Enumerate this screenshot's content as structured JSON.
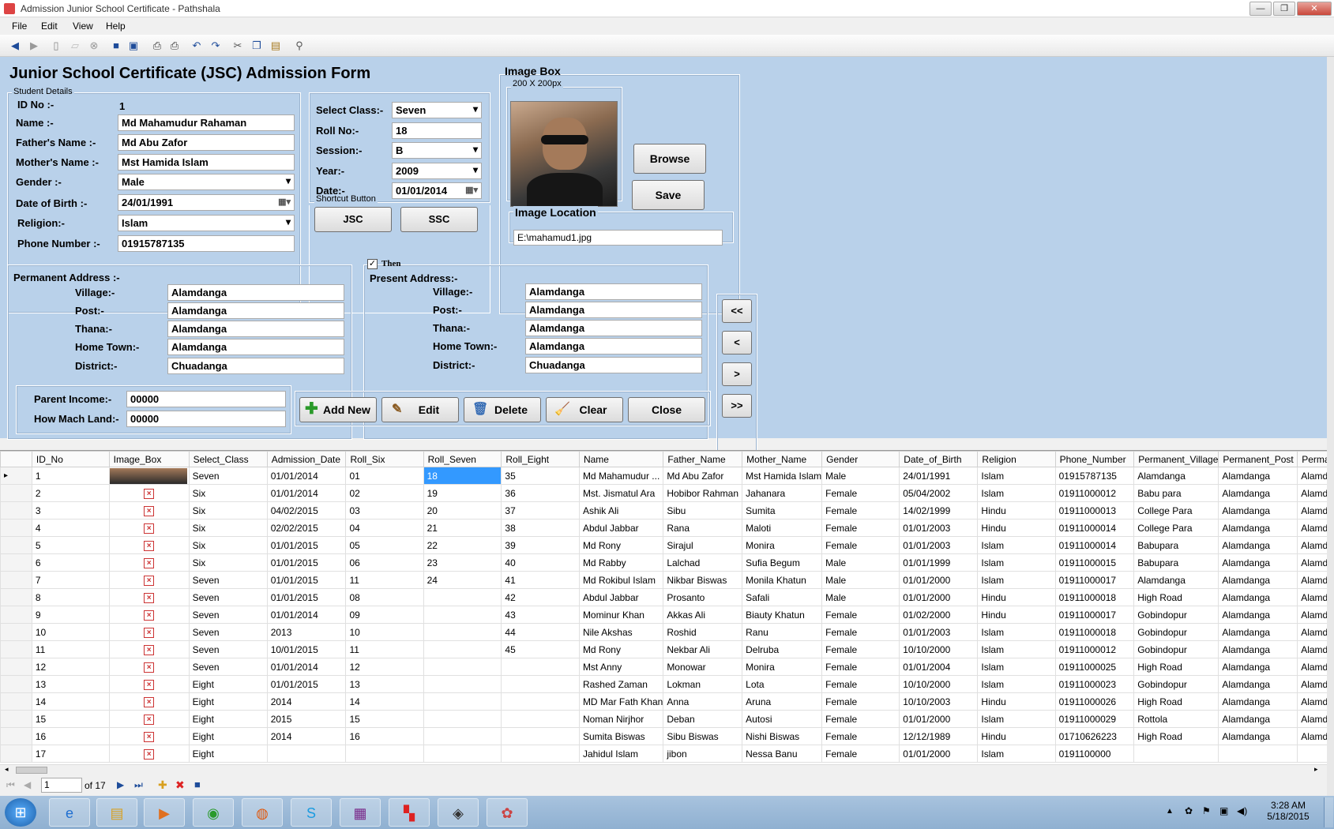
{
  "window": {
    "title": "Admission Junior School Certificate - Pathshala",
    "min": "—",
    "max": "❐",
    "close": "✕"
  },
  "menu": [
    "File",
    "Edit",
    "View",
    "Help"
  ],
  "form": {
    "title": "Junior School Certificate (JSC) Admission Form",
    "student_details_label": "Student Details",
    "id_label": "ID No :-",
    "id_value": "1",
    "name_label": "Name :-",
    "name_value": "Md Mahamudur Rahaman",
    "father_label": "Father's Name :-",
    "father_value": "Md Abu Zafor",
    "mother_label": "Mother's Name :-",
    "mother_value": "Mst Hamida Islam",
    "gender_label": "Gender   :-",
    "gender_value": "Male",
    "dob_label": "Date of Birth  :-",
    "dob_value": "24/01/1991",
    "religion_label": "Religion:-",
    "religion_value": "Islam",
    "phone_label": "Phone Number :-",
    "phone_value": "01915787135",
    "class_label": "Select Class:-",
    "class_value": "Seven",
    "roll_label": "Roll No:-",
    "roll_value": "18",
    "session_label": "Session:-",
    "session_value": "B",
    "year_label": "Year:-",
    "year_value": "2009",
    "date_label": "Date:-",
    "date_value": "01/01/2014",
    "shortcut_label": "Shortcut Button",
    "jsc": "JSC",
    "ssc": "SSC",
    "imagebox_label": "Image Box",
    "image_size": "200 X 200px",
    "browse": "Browse",
    "save": "Save",
    "image_location_label": "Image Location",
    "image_location_value": "E:\\mahamud1.jpg",
    "perm_label": "Permanent Address :-",
    "then_label": "Then",
    "present_label": "Present Address:-",
    "addr_labels": [
      "Village:-",
      "Post:-",
      "Thana:-",
      "Home Town:-",
      "District:-"
    ],
    "perm_values": [
      "Alamdanga",
      "Alamdanga",
      "Alamdanga",
      "Alamdanga",
      "Chuadanga"
    ],
    "pres_values": [
      "Alamdanga",
      "Alamdanga",
      "Alamdanga",
      "Alamdanga",
      "Chuadanga"
    ],
    "income_label": "Parent Income:-",
    "income_value": "00000",
    "land_label": "How Mach Land:-",
    "land_value": "00000",
    "add_new": "Add New",
    "edit": "Edit",
    "delete": "Delete",
    "clear": "Clear",
    "close": "Close",
    "nav_first": "<<",
    "nav_prev": "<",
    "nav_next": ">",
    "nav_last": ">>"
  },
  "grid": {
    "columns": [
      "ID_No",
      "Image_Box",
      "Select_Class",
      "Admission_Date",
      "Roll_Six",
      "Roll_Seven",
      "Roll_Eight",
      "Name",
      "Father_Name",
      "Mother_Name",
      "Gender",
      "Date_of_Birth",
      "Religion",
      "Phone_Number",
      "Permanent_Village",
      "Permanent_Post",
      "Perma"
    ],
    "rows": [
      [
        "1",
        "",
        "Seven",
        "01/01/2014",
        "01",
        "18",
        "35",
        "Md Mahamudur ...",
        "Md Abu Zafor",
        "Mst Hamida Islam",
        "Male",
        "24/01/1991",
        "Islam",
        "01915787135",
        "Alamdanga",
        "Alamdanga",
        "Alamda"
      ],
      [
        "2",
        "x",
        "Six",
        "01/01/2014",
        "02",
        "19",
        "36",
        "Mst. Jismatul Ara",
        "Hobibor Rahman",
        "Jahanara",
        "Female",
        "05/04/2002",
        "Islam",
        "01911000012",
        "Babu para",
        "Alamdanga",
        "Alamda"
      ],
      [
        "3",
        "x",
        "Six",
        "04/02/2015",
        "03",
        "20",
        "37",
        "Ashik Ali",
        "Sibu",
        "Sumita",
        "Female",
        "14/02/1999",
        "Hindu",
        "01911000013",
        "College Para",
        "Alamdanga",
        "Alamda"
      ],
      [
        "4",
        "x",
        "Six",
        "02/02/2015",
        "04",
        "21",
        "38",
        "Abdul Jabbar",
        "Rana",
        "Maloti",
        "Female",
        "01/01/2003",
        "Hindu",
        "01911000014",
        "College Para",
        "Alamdanga",
        "Alamda"
      ],
      [
        "5",
        "x",
        "Six",
        "01/01/2015",
        "05",
        "22",
        "39",
        "Md Rony",
        "Sirajul",
        "Monira",
        "Female",
        "01/01/2003",
        "Islam",
        "01911000014",
        "Babupara",
        "Alamdanga",
        "Alamda"
      ],
      [
        "6",
        "x",
        "Six",
        "01/01/2015",
        "06",
        "23",
        "40",
        "Md Rabby",
        "Lalchad",
        "Sufia Begum",
        "Male",
        "01/01/1999",
        "Islam",
        "01911000015",
        "Babupara",
        "Alamdanga",
        "Alamda"
      ],
      [
        "7",
        "x",
        "Seven",
        "01/01/2015",
        "11",
        "24",
        "41",
        "Md Rokibul Islam",
        "Nikbar Biswas",
        "Monila Khatun",
        "Male",
        "01/01/2000",
        "Islam",
        "01911000017",
        "Alamdanga",
        "Alamdanga",
        "Alamda"
      ],
      [
        "8",
        "x",
        "Seven",
        "01/01/2015",
        "08",
        "",
        "42",
        "Abdul Jabbar",
        "Prosanto",
        "Safali",
        "Male",
        "01/01/2000",
        "Hindu",
        "01911000018",
        "High Road",
        "Alamdanga",
        "Alamda"
      ],
      [
        "9",
        "x",
        "Seven",
        "01/01/2014",
        "09",
        "",
        "43",
        "Mominur Khan",
        "Akkas Ali",
        "Biauty Khatun",
        "Female",
        "01/02/2000",
        "Hindu",
        "01911000017",
        "Gobindopur",
        "Alamdanga",
        "Alamda"
      ],
      [
        "10",
        "x",
        "Seven",
        "2013",
        "10",
        "",
        "44",
        "Nile Akshas",
        "Roshid",
        "Ranu",
        "Female",
        "01/01/2003",
        "Islam",
        "01911000018",
        "Gobindopur",
        "Alamdanga",
        "Alamda"
      ],
      [
        "11",
        "x",
        "Seven",
        "10/01/2015",
        "11",
        "",
        "45",
        "Md Rony",
        "Nekbar Ali",
        "Delruba",
        "Female",
        "10/10/2000",
        "Islam",
        "01911000012",
        "Gobindopur",
        "Alamdanga",
        "Alamda"
      ],
      [
        "12",
        "x",
        "Seven",
        "01/01/2014",
        "12",
        "",
        "",
        "Mst Anny",
        "Monowar",
        "Monira",
        "Female",
        "01/01/2004",
        "Islam",
        "01911000025",
        "High Road",
        "Alamdanga",
        "Alamda"
      ],
      [
        "13",
        "x",
        "Eight",
        "01/01/2015",
        "13",
        "",
        "",
        "Rashed Zaman",
        "Lokman",
        "Lota",
        "Female",
        "10/10/2000",
        "Islam",
        "01911000023",
        "Gobindopur",
        "Alamdanga",
        "Alamda"
      ],
      [
        "14",
        "x",
        "Eight",
        "2014",
        "14",
        "",
        "",
        "MD Mar Fath Khan",
        "Anna",
        "Aruna",
        "Female",
        "10/10/2003",
        "Hindu",
        "01911000026",
        "High Road",
        "Alamdanga",
        "Alamda"
      ],
      [
        "15",
        "x",
        "Eight",
        "2015",
        "15",
        "",
        "",
        "Noman Nirjhor",
        "Deban",
        "Autosi",
        "Female",
        "01/01/2000",
        "Islam",
        "01911000029",
        "Rottola",
        "Alamdanga",
        "Alamda"
      ],
      [
        "16",
        "x",
        "Eight",
        "2014",
        "16",
        "",
        "",
        "Sumita Biswas",
        "Sibu Biswas",
        "Nishi Biswas",
        "Female",
        "12/12/1989",
        "Hindu",
        "01710626223",
        "High Road",
        "Alamdanga",
        "Alamda"
      ],
      [
        "17",
        "x",
        "Eight",
        "",
        "",
        "",
        "",
        "Jahidul Islam",
        "jibon",
        "Nessa Banu",
        "Female",
        "01/01/2000",
        "Islam",
        "0191100000",
        "",
        "",
        ""
      ]
    ]
  },
  "navigator": {
    "position": "1",
    "count": "of 17"
  },
  "clock": {
    "time": "3:28 AM",
    "date": "5/18/2015"
  }
}
